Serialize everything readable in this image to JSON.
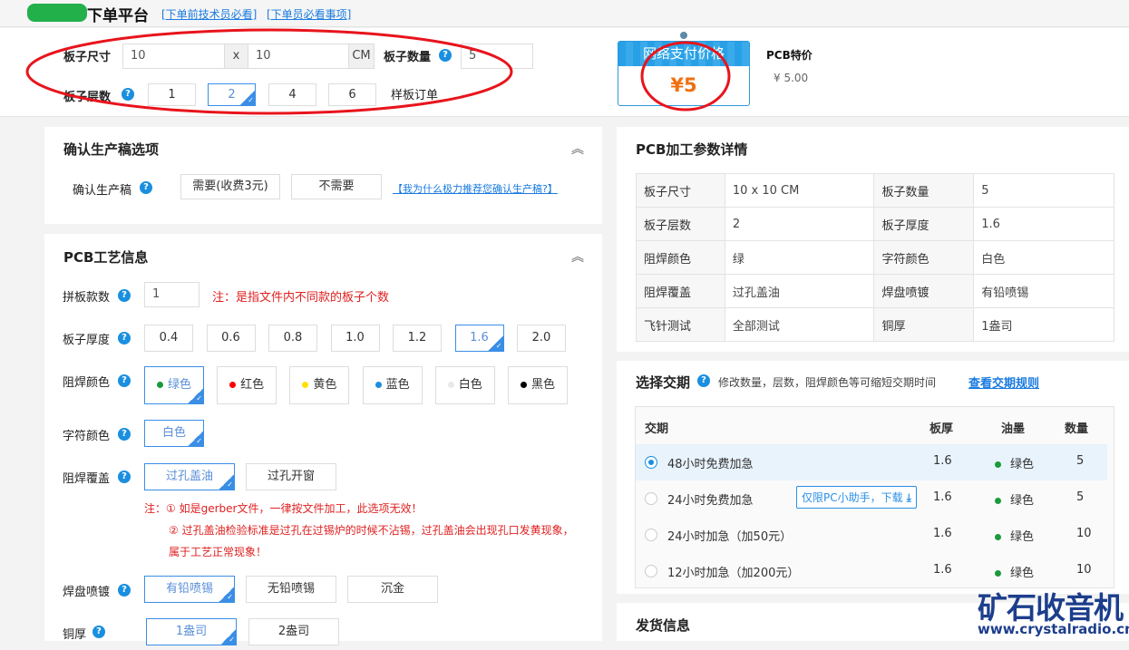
{
  "topbar": {
    "title": "下单平台",
    "links": [
      "[下单前技术员必看]",
      "[下单员必看事项]"
    ]
  },
  "header": {
    "size_label": "板子尺寸",
    "size_w": "10",
    "size_x": "x",
    "size_h": "10",
    "size_unit": "CM",
    "qty_label": "板子数量",
    "qty_value": "5",
    "layers_label": "板子层数",
    "layers": [
      "1",
      "2",
      "4",
      "6"
    ],
    "layers_selected": "2",
    "order_type": "样板订单",
    "price_tag_title": "网络支付价格",
    "price_tag_value": "¥5",
    "special_label": "PCB特价",
    "special_value": "¥ 5.00"
  },
  "confirm": {
    "title": "确认生产稿选项",
    "label": "确认生产稿",
    "options": [
      "需要(收费3元)",
      "不需要"
    ],
    "link": "【我为什么极力推荐您确认生产稿?】"
  },
  "craft": {
    "title": "PCB工艺信息",
    "panel_label": "拼板款数",
    "panel_value": "1",
    "panel_note": "注：是指文件内不同款的板子个数",
    "thickness_label": "板子厚度",
    "thickness": [
      "0.4",
      "0.6",
      "0.8",
      "1.0",
      "1.2",
      "1.6",
      "2.0"
    ],
    "thickness_selected": "1.6",
    "mask_label": "阻焊颜色",
    "mask_colors": [
      {
        "label": "绿色",
        "color": "#1a9a3a"
      },
      {
        "label": "红色",
        "color": "#ff0000"
      },
      {
        "label": "黄色",
        "color": "#ffe000"
      },
      {
        "label": "蓝色",
        "color": "#1a8fe0"
      },
      {
        "label": "白色",
        "color": "#e8e8e8"
      },
      {
        "label": "黑色",
        "color": "#000000"
      }
    ],
    "mask_selected": "绿色",
    "silk_label": "字符颜色",
    "silk_options": [
      "白色"
    ],
    "cover_label": "阻焊覆盖",
    "cover_options": [
      "过孔盖油",
      "过孔开窗"
    ],
    "cover_notes": [
      "注：① 如是gerber文件，一律按文件加工，此选项无效！",
      "② 过孔盖油检验标准是过孔在过锡炉的时候不沾锡，过孔盖油会出现孔口发黄现象，",
      "属于工艺正常现象！"
    ],
    "finish_label": "焊盘喷镀",
    "finish_options": [
      "有铅喷锡",
      "无铅喷锡",
      "沉金"
    ],
    "copper_label": "铜厚",
    "copper_options": [
      "1盎司",
      "2盎司"
    ]
  },
  "params": {
    "title": "PCB加工参数详情",
    "rows": [
      [
        "板子尺寸",
        "10 x 10 CM",
        "板子数量",
        "5"
      ],
      [
        "板子层数",
        "2",
        "板子厚度",
        "1.6"
      ],
      [
        "阻焊颜色",
        "绿",
        "字符颜色",
        "白色"
      ],
      [
        "阻焊覆盖",
        "过孔盖油",
        "焊盘喷镀",
        "有铅喷锡"
      ],
      [
        "飞针测试",
        "全部测试",
        "铜厚",
        "1盎司"
      ]
    ]
  },
  "delivery": {
    "title": "选择交期",
    "hint": "修改数量，层数，阻焊颜色等可缩短交期时间",
    "link": "查看交期规则",
    "headers": [
      "交期",
      "板厚",
      "油墨",
      "数量"
    ],
    "rows": [
      {
        "label": "48小时免费加急",
        "thickness": "1.6",
        "ink": "绿色",
        "qty": "5",
        "selected": true
      },
      {
        "label": "24小时免费加急",
        "thickness": "1.6",
        "ink": "绿色",
        "qty": "5",
        "badge": "仅限PC小助手，下载"
      },
      {
        "label": "24小时加急（加50元）",
        "thickness": "1.6",
        "ink": "绿色",
        "qty": "10"
      },
      {
        "label": "12小时加急（加200元）",
        "thickness": "1.6",
        "ink": "绿色",
        "qty": "10"
      }
    ],
    "ink_color": "#1a9a3a"
  },
  "shipping": {
    "title": "发货信息"
  },
  "watermark": {
    "name": "矿石收音机",
    "url": "www.crystalradio.cn"
  }
}
